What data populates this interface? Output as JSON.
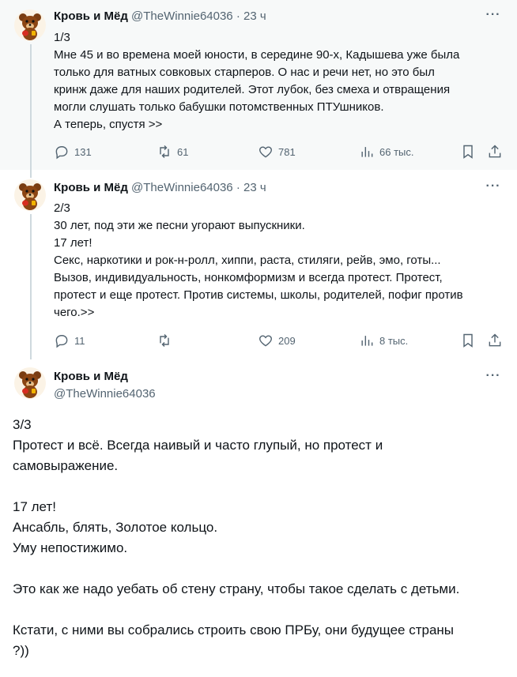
{
  "tweets": [
    {
      "author": "Кровь и Мёд",
      "handle": "@TheWinnie64036",
      "time": "· 23 ч",
      "lines": [
        "1/3",
        "Мне 45 и во времена моей юности, в середине 90-х, Кадышева уже была",
        "только для ватных совковых старперов. О нас и речи нет, но это был",
        "кринж даже для наших родителей. Этот лубок, без смеха и отвращения",
        "могли слушать только бабушки потомственных ПТУшников.",
        "А теперь, спустя >>"
      ],
      "replies": "131",
      "retweets": "61",
      "likes": "781",
      "views": "66 тыс."
    },
    {
      "author": "Кровь и Мёд",
      "handle": "@TheWinnie64036",
      "time": "· 23 ч",
      "lines": [
        "2/3",
        "30 лет, под эти же песни угорают выпускники.",
        "17 лет!",
        "Секс, наркотики и рок-н-ролл, хиппи, раста, стиляги, рейв, эмо, готы...",
        "Вызов, индивидуальность, нонкомформизм и всегда протест. Протест,",
        "протест и еще протест. Против системы, школы, родителей, пофиг против",
        "чего.>>"
      ],
      "replies": "11",
      "retweets": "",
      "likes": "209",
      "views": "8 тыс."
    },
    {
      "author": "Кровь и Мёд",
      "handle": "@TheWinnie64036",
      "lines": [
        "3/3",
        "Протест и всё. Всегда наивый и часто глупый, но протест и",
        "самовыражение.",
        "",
        "17 лет!",
        "Ансабль, блять, Золотое кольцо.",
        "Уму непостижимо.",
        "",
        "Это как же надо уебать об стену страну, чтобы такое сделать с детьми.",
        "",
        "Кстати, с ними вы собрались строить свою ПРБу, они будущее страны",
        "?))"
      ]
    }
  ],
  "more_label": "···",
  "colors": {
    "text": "#0f1419",
    "secondary": "#536471",
    "thread_line": "#cfd9de",
    "highlight_bg": "#f7f9f9"
  },
  "icons": [
    "reply-icon",
    "retweet-icon",
    "like-icon",
    "views-icon",
    "bookmark-icon",
    "share-icon"
  ]
}
